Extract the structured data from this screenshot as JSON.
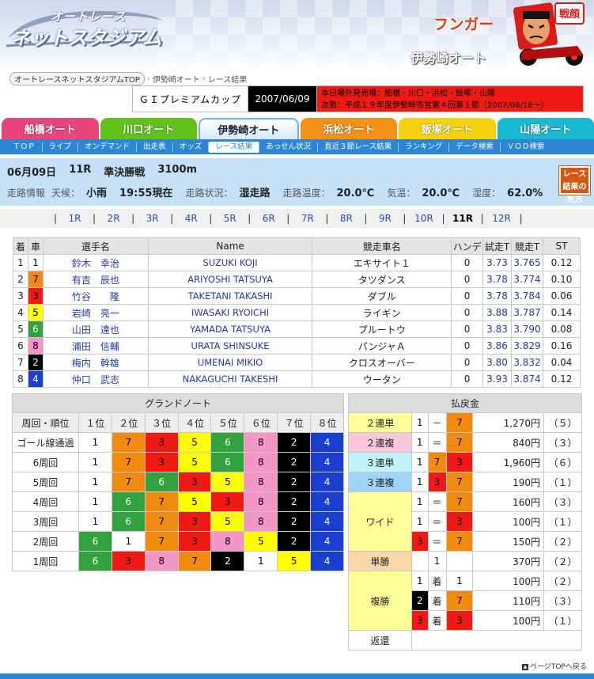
{
  "header": {
    "logo_top": "オートレース",
    "logo_main": "ネットスタジアム",
    "brand_word": "フンガー",
    "mascot_badge": "戦顔",
    "venue_title": "伊勢崎オート"
  },
  "breadcrumb": {
    "home": "オートレースネットスタジアムTOP",
    "items": [
      "伊勢崎オート",
      "レース結果"
    ]
  },
  "race_info": {
    "title": "ＧＩプレミアムカップ",
    "date": "2007/06/09",
    "offsite": "本日場外発売場：船橋・川口・浜松・飯塚・山陽",
    "next": "次節：平成１９年度伊勢崎市営第４回第１節（2007/06/16～）"
  },
  "venue_tabs": [
    {
      "label": "船橋オート",
      "color": "#e8457a"
    },
    {
      "label": "川口オート",
      "color": "#62c21c"
    },
    {
      "label": "伊勢崎オート",
      "color": "#3a9de0"
    },
    {
      "label": "浜松オート",
      "color": "#f39018"
    },
    {
      "label": "飯塚オート",
      "color": "#f6d10f"
    },
    {
      "label": "山陽オート",
      "color": "#19b9d2"
    }
  ],
  "sub_nav": [
    "ＴＯＰ",
    "ライブ",
    "オンデマンド",
    "出走表",
    "オッズ",
    "レース結果",
    "あっせん状況",
    "直近３節レース結果",
    "ランキング",
    "データ検索",
    "ＶＯＤ検索"
  ],
  "race_header": {
    "date": "06月09日",
    "race_no": "11R",
    "race_name": "準決勝戦",
    "distance": "3100m",
    "track_info_label": "走路情報",
    "weather_label": "天候：",
    "weather": "小雨",
    "time": "19:55現在",
    "track_state_label": "走路状況：",
    "track_state": "湿走路",
    "track_temp_label": "走路温度：",
    "track_temp": "20.0℃",
    "air_temp_label": "気温：",
    "air_temp": "20.0℃",
    "humidity_label": "湿度：",
    "humidity": "62.0%",
    "guide_button": "レース結果の見方"
  },
  "race_nav": [
    "1R",
    "2R",
    "3R",
    "4R",
    "5R",
    "6R",
    "7R",
    "8R",
    "9R",
    "10R",
    "11R",
    "12R"
  ],
  "results": {
    "headers": [
      "着",
      "車",
      "選手名",
      "Name",
      "競走車名",
      "ハンデ",
      "試走T",
      "競走T",
      "ST"
    ],
    "rows": [
      {
        "pos": "1",
        "car": "1",
        "jp": "鈴木　幸治",
        "en": "SUZUKI KOJI",
        "bike": "エキサイト１",
        "handicap": "0",
        "trial": "3.73",
        "race": "3.765",
        "st": "0.12"
      },
      {
        "pos": "2",
        "car": "7",
        "jp": "有吉　辰也",
        "en": "ARIYOSHI TATSUYA",
        "bike": "タツダンス",
        "handicap": "0",
        "trial": "3.78",
        "race": "3.774",
        "st": "0.10"
      },
      {
        "pos": "3",
        "car": "3",
        "jp": "竹谷　　隆",
        "en": "TAKETANI TAKASHI",
        "bike": "ダブル",
        "handicap": "0",
        "trial": "3.78",
        "race": "3.784",
        "st": "0.06"
      },
      {
        "pos": "4",
        "car": "5",
        "jp": "岩崎　亮一",
        "en": "IWASAKI RYOICHI",
        "bike": "ライギン",
        "handicap": "0",
        "trial": "3.88",
        "race": "3.787",
        "st": "0.14"
      },
      {
        "pos": "5",
        "car": "6",
        "jp": "山田　達也",
        "en": "YAMADA TATSUYA",
        "bike": "プルートウ",
        "handicap": "0",
        "trial": "3.83",
        "race": "3.790",
        "st": "0.08"
      },
      {
        "pos": "6",
        "car": "8",
        "jp": "浦田　信輔",
        "en": "URATA SHINSUKE",
        "bike": "パンジャＡ",
        "handicap": "0",
        "trial": "3.86",
        "race": "3.829",
        "st": "0.16"
      },
      {
        "pos": "7",
        "car": "2",
        "jp": "梅内　幹雄",
        "en": "UMENAI MIKIO",
        "bike": "クロスオーバー",
        "handicap": "0",
        "trial": "3.80",
        "race": "3.832",
        "st": "0.04"
      },
      {
        "pos": "8",
        "car": "4",
        "jp": "仲口　武志",
        "en": "NAKAGUCHI TAKESHI",
        "bike": "ウータン",
        "handicap": "0",
        "trial": "3.93",
        "race": "3.874",
        "st": "0.12"
      }
    ]
  },
  "grand_note": {
    "title": "グランドノート",
    "headers": [
      "周回・順位",
      "１位",
      "２位",
      "３位",
      "４位",
      "５位",
      "６位",
      "７位",
      "８位"
    ],
    "rows": [
      {
        "label": "ゴール線通過",
        "cars": [
          "1",
          "7",
          "3",
          "5",
          "6",
          "8",
          "2",
          "4"
        ]
      },
      {
        "label": "6周回",
        "cars": [
          "1",
          "7",
          "3",
          "5",
          "6",
          "8",
          "2",
          "4"
        ]
      },
      {
        "label": "5周回",
        "cars": [
          "1",
          "7",
          "6",
          "3",
          "5",
          "8",
          "2",
          "4"
        ]
      },
      {
        "label": "4周回",
        "cars": [
          "1",
          "6",
          "7",
          "5",
          "3",
          "8",
          "2",
          "4"
        ]
      },
      {
        "label": "3周回",
        "cars": [
          "1",
          "6",
          "7",
          "3",
          "5",
          "8",
          "2",
          "4"
        ]
      },
      {
        "label": "2周回",
        "cars": [
          "6",
          "1",
          "7",
          "3",
          "8",
          "5",
          "2",
          "4"
        ]
      },
      {
        "label": "1周回",
        "cars": [
          "6",
          "3",
          "8",
          "7",
          "2",
          "1",
          "5",
          "4"
        ]
      }
    ]
  },
  "payout": {
    "title": "払戻金",
    "rows": [
      {
        "bet": "２連単",
        "a": "1",
        "op1": "－",
        "b": "7",
        "op2": "",
        "c": "",
        "amount": "1,270円",
        "pop": "（５）"
      },
      {
        "bet": "２連複",
        "a": "1",
        "op1": "＝",
        "b": "7",
        "op2": "",
        "c": "",
        "amount": "840円",
        "pop": "（３）"
      },
      {
        "bet": "３連単",
        "a": "1",
        "op1": "",
        "b": "7",
        "op2": "",
        "c": "3",
        "amount": "1,960円",
        "pop": "（６）"
      },
      {
        "bet": "３連複",
        "a": "1",
        "op1": "",
        "b": "3",
        "op2": "",
        "c": "7",
        "amount": "190円",
        "pop": "（１）"
      },
      {
        "bet": "ワイド",
        "a": "1",
        "op1": "＝",
        "b": "7",
        "op2": "",
        "c": "",
        "amount": "160円",
        "pop": "（３）"
      },
      {
        "bet": "",
        "a": "1",
        "op1": "＝",
        "b": "3",
        "op2": "",
        "c": "",
        "amount": "100円",
        "pop": "（１）"
      },
      {
        "bet": "",
        "a": "3",
        "op1": "＝",
        "b": "7",
        "op2": "",
        "c": "",
        "amount": "150円",
        "pop": "（２）"
      },
      {
        "bet": "単勝",
        "a": "",
        "op1": "",
        "b": "1",
        "op2": "",
        "c": "",
        "amount": "370円",
        "pop": "（２）"
      },
      {
        "bet": "複勝",
        "a": "1",
        "op1": "着",
        "b": "1",
        "op2": "",
        "c": "",
        "amount": "100円",
        "pop": "（２）"
      },
      {
        "bet": "",
        "a": "2",
        "op1": "着",
        "b": "7",
        "op2": "",
        "c": "",
        "amount": "110円",
        "pop": "（３）"
      },
      {
        "bet": "",
        "a": "3",
        "op1": "着",
        "b": "3",
        "op2": "",
        "c": "",
        "amount": "100円",
        "pop": "（１）"
      },
      {
        "bet": "返還",
        "a": "",
        "op1": "",
        "b": "",
        "op2": "",
        "c": "",
        "amount": "",
        "pop": ""
      }
    ]
  },
  "footer": {
    "page_top": "ページTOPへ戻る"
  }
}
